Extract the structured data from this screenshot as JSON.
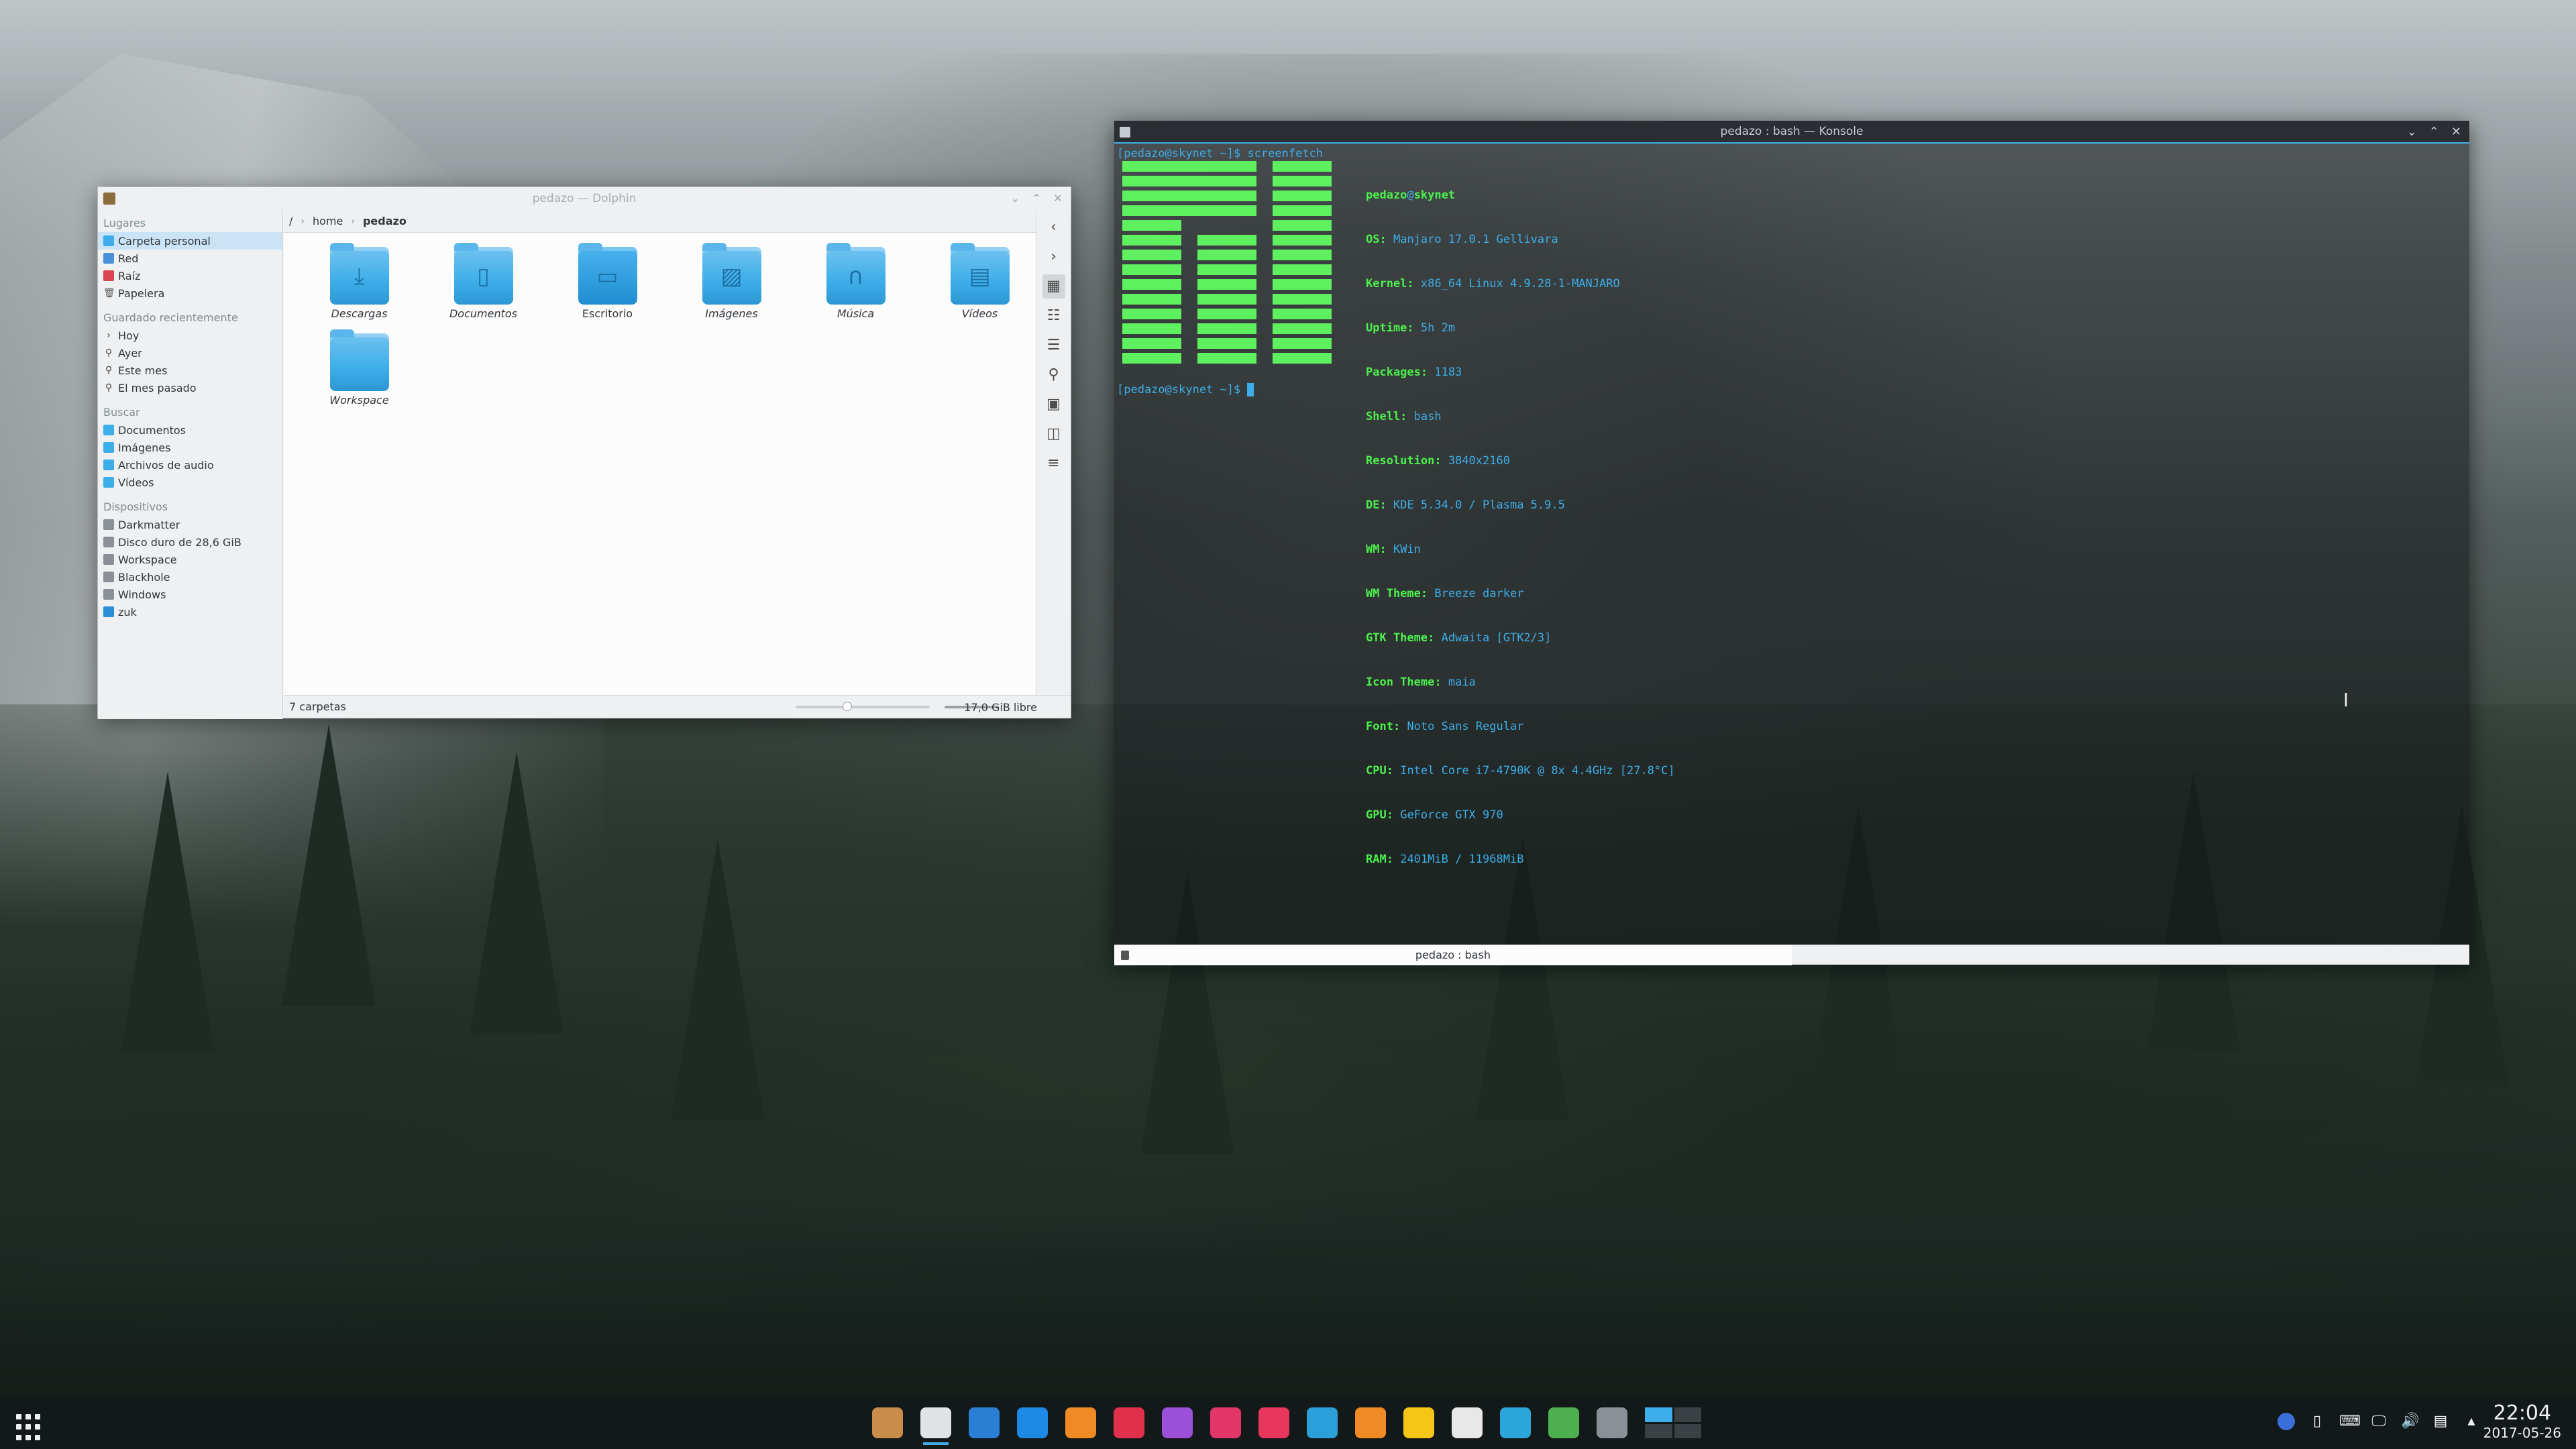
{
  "dolphin": {
    "title": "pedazo — Dolphin",
    "sidebar": {
      "places_head": "Lugares",
      "places": [
        "Carpeta personal",
        "Red",
        "Raíz",
        "Papelera"
      ],
      "recent_head": "Guardado recientemente",
      "recent": [
        "Hoy",
        "Ayer",
        "Este mes",
        "El mes pasado"
      ],
      "search_head": "Buscar",
      "search": [
        "Documentos",
        "Imágenes",
        "Archivos de audio",
        "Vídeos"
      ],
      "devices_head": "Dispositivos",
      "devices": [
        "Darkmatter",
        "Disco duro de 28,6 GiB",
        "Workspace",
        "Blackhole",
        "Windows",
        "zuk"
      ]
    },
    "breadcrumb": {
      "root": "/",
      "home": "home",
      "current": "pedazo"
    },
    "folders": [
      "Descargas",
      "Documentos",
      "Escritorio",
      "Imágenes",
      "Música",
      "Vídeos",
      "Workspace"
    ],
    "status": {
      "count": "7 carpetas",
      "free": "17,0 GiB libre"
    }
  },
  "konsole": {
    "title": "pedazo : bash — Konsole",
    "prompt1": "[pedazo@skynet ~]$ screenfetch",
    "prompt2": "[pedazo@skynet ~]$ ",
    "user": "pedazo",
    "at": "@",
    "host": "skynet",
    "info": [
      {
        "k": "OS:",
        "v": "Manjaro 17.0.1 Gellivara"
      },
      {
        "k": "Kernel:",
        "v": "x86_64 Linux 4.9.28-1-MANJARO"
      },
      {
        "k": "Uptime:",
        "v": "5h 2m"
      },
      {
        "k": "Packages:",
        "v": "1183"
      },
      {
        "k": "Shell:",
        "v": "bash"
      },
      {
        "k": "Resolution:",
        "v": "3840x2160"
      },
      {
        "k": "DE:",
        "v": "KDE 5.34.0 / Plasma 5.9.5"
      },
      {
        "k": "WM:",
        "v": "KWin"
      },
      {
        "k": "WM Theme:",
        "v": "Breeze darker"
      },
      {
        "k": "GTK Theme:",
        "v": "Adwaita [GTK2/3]"
      },
      {
        "k": "Icon Theme:",
        "v": "maia"
      },
      {
        "k": "Font:",
        "v": "Noto Sans Regular"
      },
      {
        "k": "CPU:",
        "v": "Intel Core i7-4790K @ 8x 4.4GHz [27.8°C]"
      },
      {
        "k": "GPU:",
        "v": "GeForce GTX 970"
      },
      {
        "k": "RAM:",
        "v": "2401MiB / 11968MiB"
      }
    ],
    "tab": "pedazo : bash"
  },
  "panel": {
    "time": "22:04",
    "date": "2017-05-26",
    "task_colors": [
      "#c98c4b",
      "#dfe3e6",
      "#2a7fd4",
      "#1e88e5",
      "#f08a24",
      "#e0304c",
      "#9c4fd8",
      "#e2366b",
      "#e8365d",
      "#2a9fd8",
      "#f08a24",
      "#f5c518",
      "#e8e8e8",
      "#2aa6d8",
      "#4caf50",
      "#8a9096"
    ]
  },
  "colors": {
    "accent": "#3daee9",
    "logo_green": "#5ff05f"
  }
}
